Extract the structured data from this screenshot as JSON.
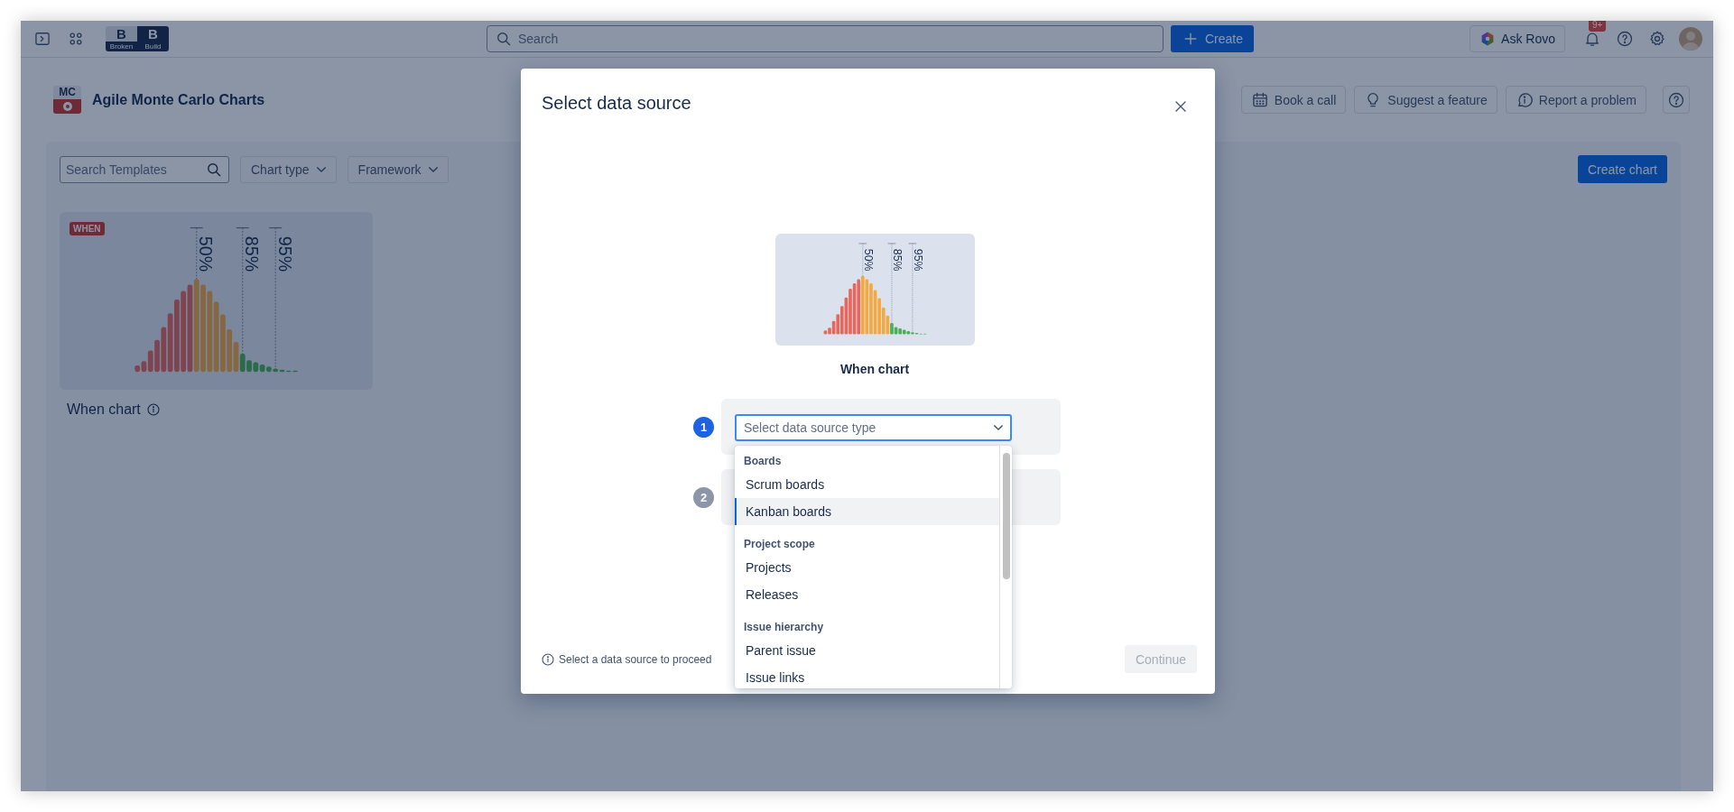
{
  "topbar": {
    "logo": {
      "letters": [
        "B",
        "B"
      ],
      "captions": [
        "Broken",
        "Build"
      ]
    },
    "search": {
      "placeholder": "Search"
    },
    "create_button": "Create",
    "ask_button": "Ask Rovo",
    "notification_badge": "9+"
  },
  "app_header": {
    "logo_text": "MC",
    "title": "Agile Monte Carlo Charts",
    "buttons": [
      "Book a call",
      "Suggest a feature",
      "Report a problem"
    ]
  },
  "toolbar": {
    "search": {
      "placeholder": "Search Templates"
    },
    "filters": [
      "Chart type",
      "Framework"
    ],
    "create_button": "Create chart"
  },
  "templates": [
    {
      "badge": "WHEN",
      "title": "When chart",
      "markers": [
        "50%",
        "85%",
        "95%"
      ]
    }
  ],
  "modal": {
    "title": "Select data source",
    "preview": {
      "markers": [
        "50%",
        "85%",
        "95%"
      ],
      "caption": "When chart"
    },
    "steps": [
      {
        "number": "1",
        "active": true,
        "select": {
          "placeholder": "Select data source type",
          "expanded": true,
          "groups": [
            {
              "header": "Boards",
              "items": [
                {
                  "label": "Scrum boards",
                  "selected": false
                },
                {
                  "label": "Kanban boards",
                  "selected": true
                }
              ]
            },
            {
              "header": "Project scope",
              "items": [
                {
                  "label": "Projects",
                  "selected": false
                },
                {
                  "label": "Releases",
                  "selected": false
                }
              ]
            },
            {
              "header": "Issue hierarchy",
              "items": [
                {
                  "label": "Parent issue",
                  "selected": false
                },
                {
                  "label": "Issue links",
                  "selected": false
                }
              ]
            }
          ]
        }
      },
      {
        "number": "2",
        "active": false
      }
    ],
    "hint": "Select a data source to proceed",
    "continue": {
      "label": "Continue",
      "disabled": true
    }
  }
}
